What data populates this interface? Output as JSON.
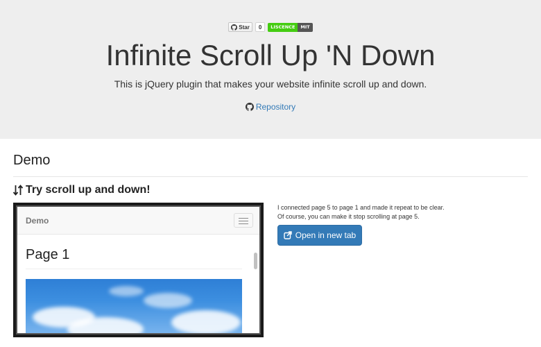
{
  "header": {
    "star_label": "Star",
    "star_count": "0",
    "licence_label": "LISCENCE",
    "licence_value": "MIT",
    "title": "Infinite Scroll Up 'N Down",
    "lead": "This is jQuery plugin that makes your website infinite scroll up and down.",
    "repo_label": "Repository"
  },
  "demo": {
    "heading": "Demo",
    "try_heading": "Try scroll up and down!",
    "frame": {
      "brand": "Demo",
      "page_title": "Page 1"
    },
    "description_line1": "I connected page 5 to page 1 and made it repeat to be clear.",
    "description_line2": "Of course, you can make it stop scrolling at page 5.",
    "open_button_label": "Open in new tab"
  },
  "colors": {
    "jumbotron_bg": "#eeeeee",
    "link": "#337ab7",
    "primary_button": "#337ab7",
    "licence_green": "#44cc11",
    "licence_grey": "#555555"
  },
  "icons": [
    "github-icon",
    "sort-arrows-icon",
    "external-link-icon",
    "hamburger-icon"
  ]
}
